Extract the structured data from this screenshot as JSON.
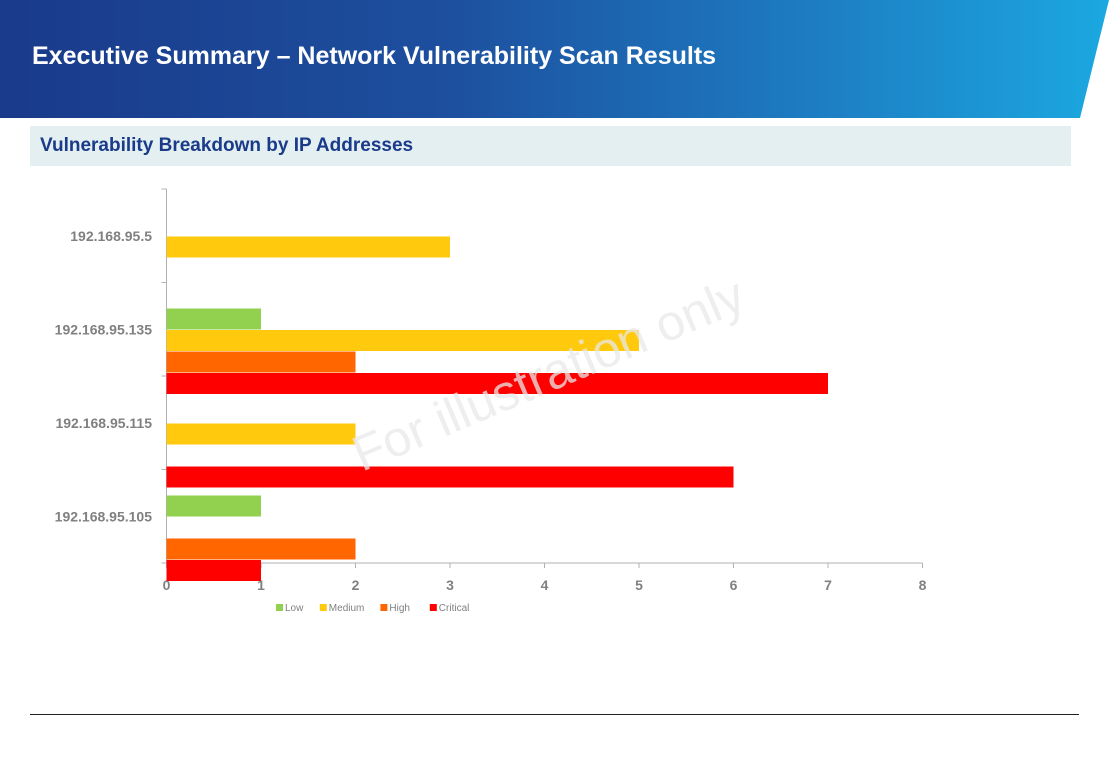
{
  "header": {
    "title": "Executive Summary – Network Vulnerability Scan Results"
  },
  "section": {
    "title": "Vulnerability Breakdown by IP Addresses"
  },
  "watermark": "For illustration only",
  "chart_data": {
    "type": "bar",
    "orientation": "horizontal",
    "categories": [
      "192.168.95.5",
      "192.168.95.135",
      "192.168.95.115",
      "192.168.95.105"
    ],
    "series": [
      {
        "name": "Low",
        "color": "#92d050",
        "values": [
          0,
          1,
          0,
          1
        ]
      },
      {
        "name": "Medium",
        "color": "#ffc90e",
        "values": [
          3,
          5,
          2,
          0
        ]
      },
      {
        "name": "High",
        "color": "#ff6600",
        "values": [
          0,
          2,
          0,
          2
        ]
      },
      {
        "name": "Critical",
        "color": "#ff0000",
        "values": [
          0,
          7,
          6,
          1
        ]
      }
    ],
    "xlim": [
      0,
      8
    ],
    "xticks": [
      0,
      1,
      2,
      3,
      4,
      5,
      6,
      7,
      8
    ],
    "grid": false,
    "legend": "bottom"
  }
}
